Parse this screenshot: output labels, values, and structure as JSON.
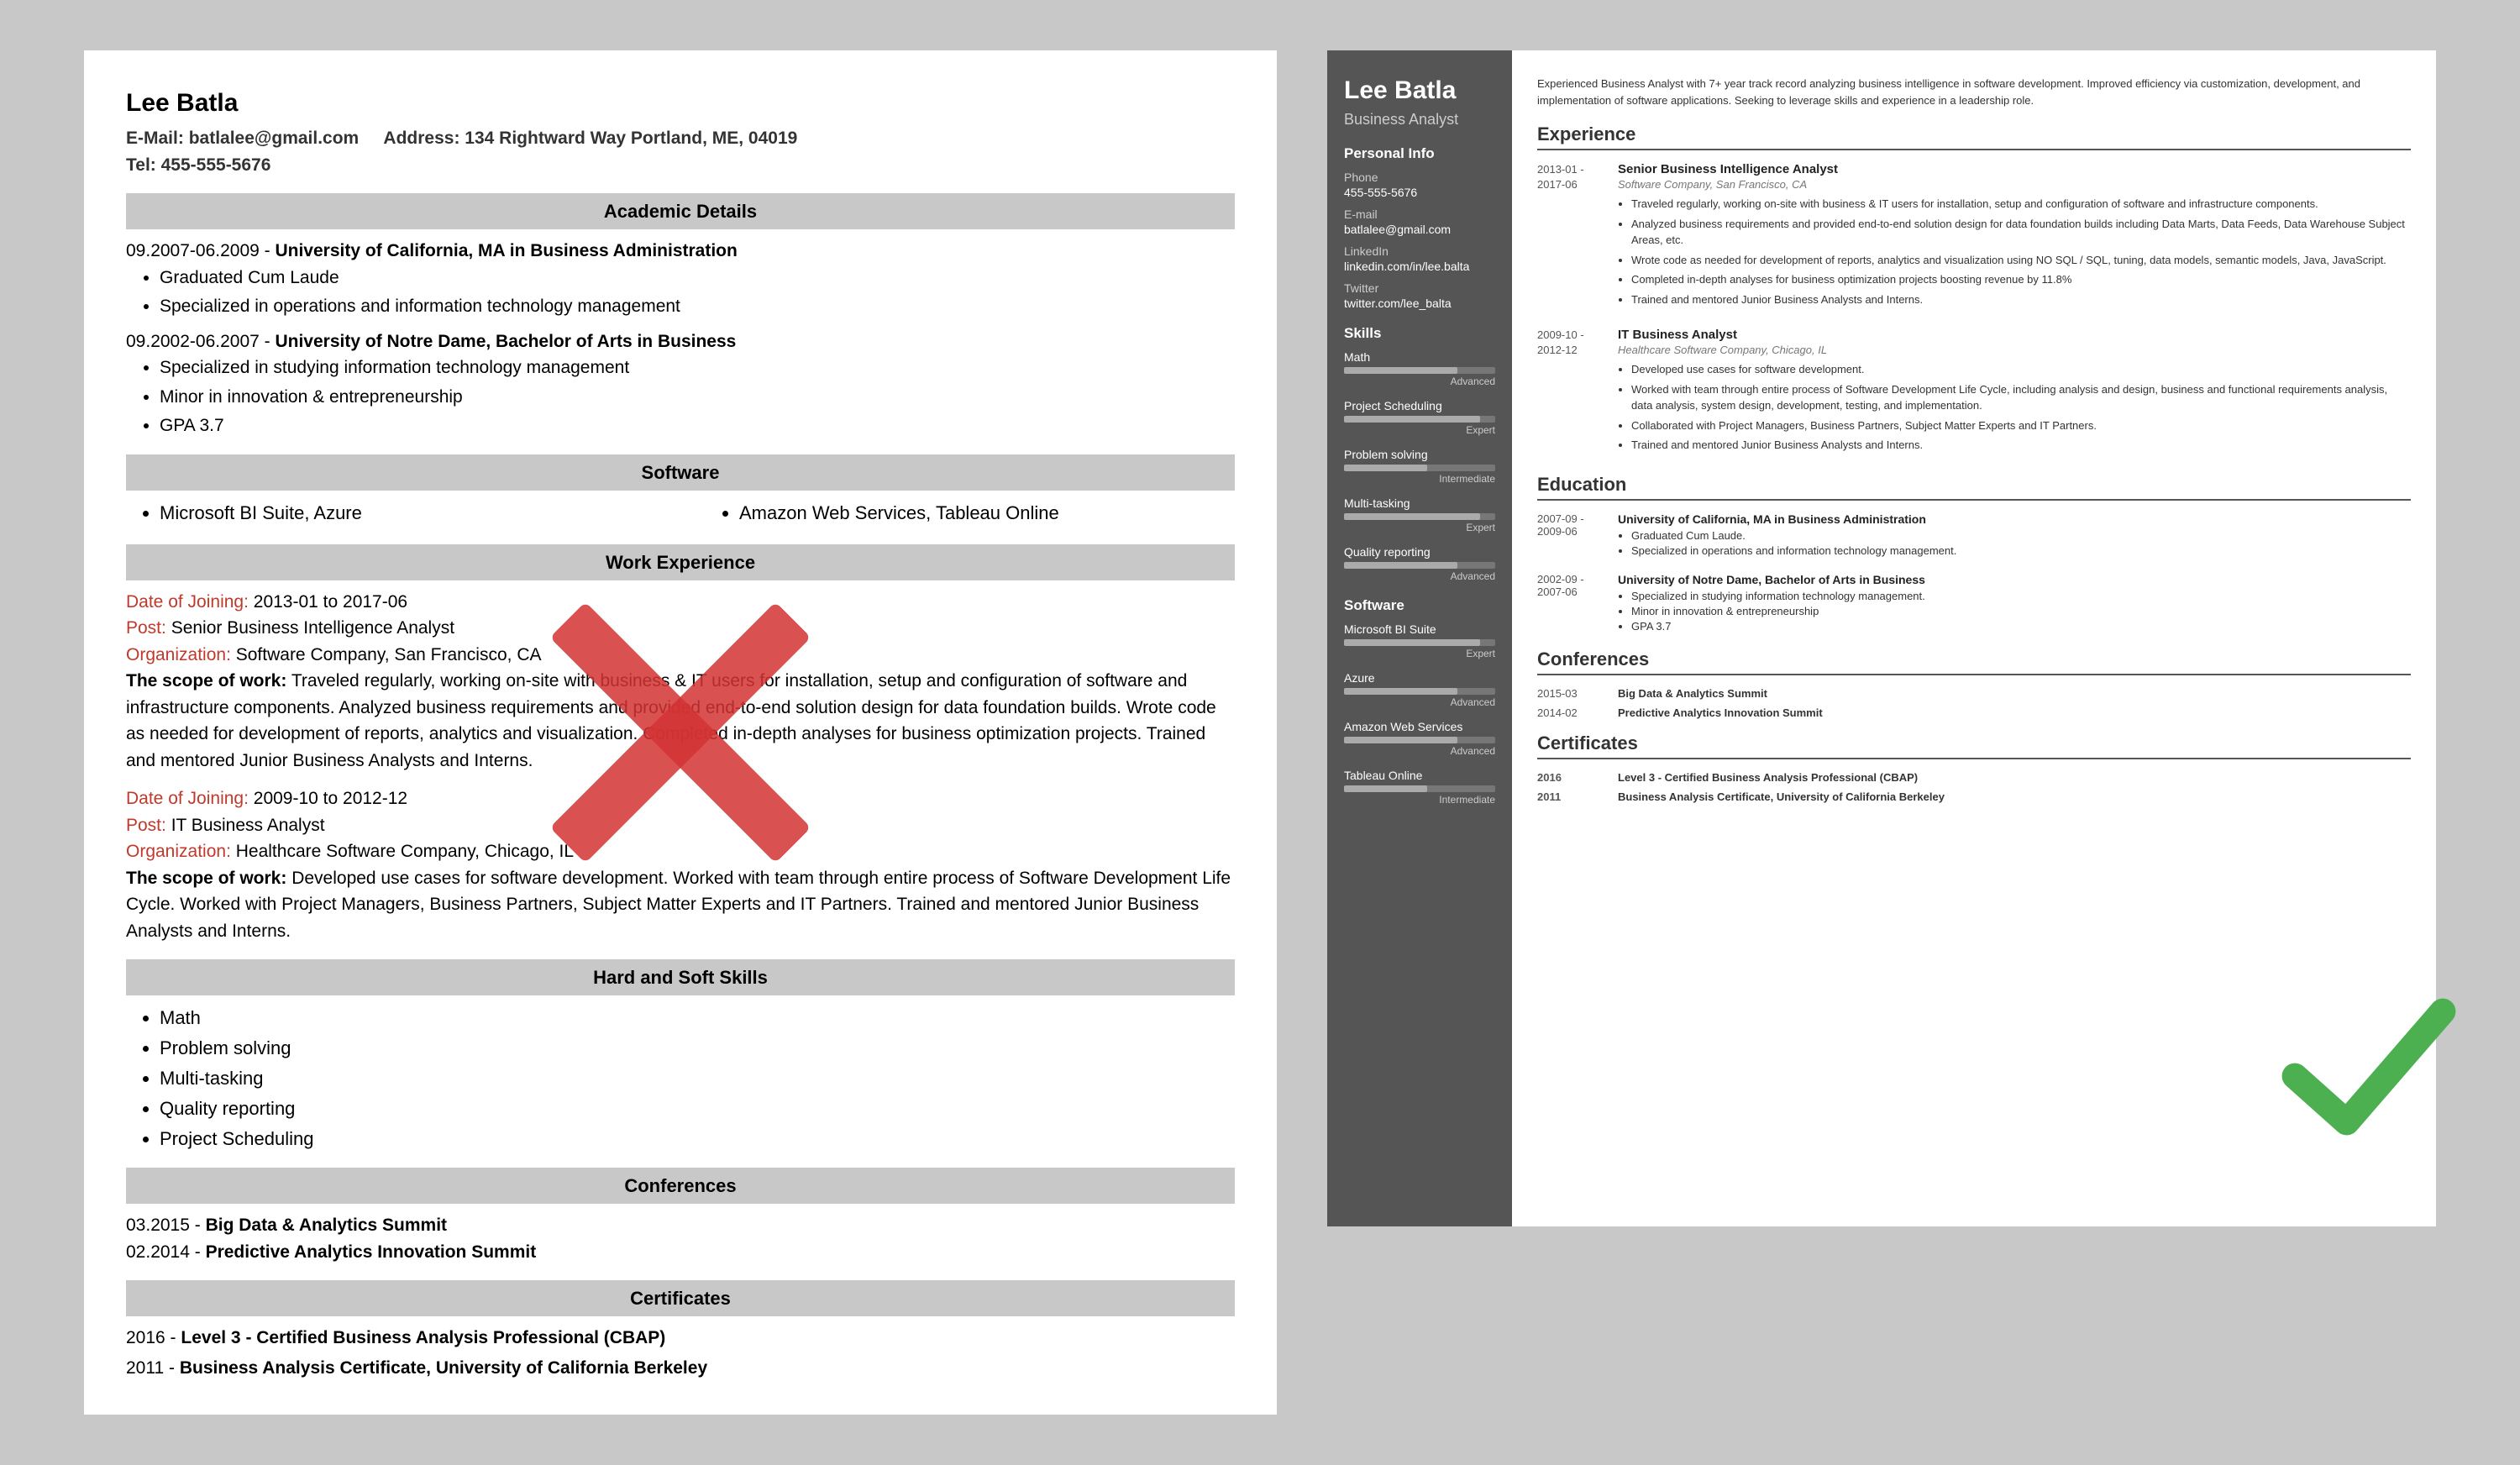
{
  "left_resume": {
    "name": "Lee Batla",
    "email_label": "E-Mail:",
    "email": "batlalee@gmail.com",
    "address_label": "Address:",
    "address": "134 Rightward Way Portland, ME, 04019",
    "tel_label": "Tel:",
    "tel": "455-555-5676",
    "sections": {
      "academic": "Academic Details",
      "software": "Software",
      "work": "Work Experience",
      "skills": "Hard and Soft Skills",
      "conferences": "Conferences",
      "certificates": "Certificates"
    },
    "education": [
      {
        "dates": "09.2007-06.2009",
        "degree": "University of California, MA in Business Administration",
        "bullets": [
          "Graduated Cum Laude",
          "Specialized in operations and information technology management"
        ]
      },
      {
        "dates": "09.2002-06.2007",
        "degree": "University of Notre Dame, Bachelor of Arts in Business",
        "bullets": [
          "Specialized in studying information technology management",
          "Minor in innovation & entrepreneurship",
          "GPA 3.7"
        ]
      }
    ],
    "software_items": [
      "Microsoft BI Suite, Azure",
      "Amazon Web Services, Tableau Online"
    ],
    "work": [
      {
        "date_label": "Date of Joining:",
        "dates": "2013-01 to 2017-06",
        "post_label": "Post:",
        "post": "Senior Business Intelligence Analyst",
        "org_label": "Organization:",
        "org": "Software Company, San Francisco, CA",
        "scope_label": "The scope of work:",
        "scope": "Traveled regularly, working on-site with business & IT users for installation, setup and configuration of software and infrastructure components. Analyzed business requirements and provided end-to-end solution design for data foundation builds. Wrote code as needed for development of reports, analytics and visualization. Completed in-depth analyses for business optimization projects. Trained and mentored Junior Business Analysts and Interns."
      },
      {
        "date_label": "Date of Joining:",
        "dates": "2009-10 to 2012-12",
        "post_label": "Post:",
        "post": "IT Business Analyst",
        "org_label": "Organization:",
        "org": "Healthcare Software Company, Chicago, IL",
        "scope_label": "The scope of work:",
        "scope": "Developed use cases for software development. Worked with team through entire process of Software Development Life Cycle. Worked with Project Managers, Business Partners, Subject Matter Experts and IT Partners. Trained and mentored Junior Business Analysts and Interns."
      }
    ],
    "skills": [
      "Math",
      "Problem solving",
      "Multi-tasking",
      "Quality reporting",
      "Project Scheduling"
    ],
    "conferences": [
      {
        "date": "03.2015",
        "name": "Big Data & Analytics Summit"
      },
      {
        "date": "02.2014",
        "name": "Predictive Analytics Innovation Summit"
      }
    ],
    "certificates": [
      {
        "year": "2016",
        "name": "Level 3 - Certified Business Analysis Professional (CBAP)"
      },
      {
        "year": "2011",
        "name": "Business Analysis Certificate, University of California Berkeley"
      }
    ]
  },
  "right_resume": {
    "name": "Lee Batla",
    "title": "Business Analyst",
    "summary": "Experienced Business Analyst with 7+ year track record analyzing business intelligence in software development. Improved efficiency via customization, development, and implementation of software applications. Seeking to leverage skills and experience in a leadership role.",
    "personal_info_title": "Personal Info",
    "phone_label": "Phone",
    "phone": "455-555-5676",
    "email_label": "E-mail",
    "email": "batlalee@gmail.com",
    "linkedin_label": "LinkedIn",
    "linkedin": "linkedin.com/in/lee.balta",
    "twitter_label": "Twitter",
    "twitter": "twitter.com/lee_balta",
    "skills_title": "Skills",
    "skills": [
      {
        "name": "Math",
        "level": "Advanced",
        "pct": 75
      },
      {
        "name": "Project Scheduling",
        "level": "Expert",
        "pct": 90
      },
      {
        "name": "Problem solving",
        "level": "Intermediate",
        "pct": 55
      },
      {
        "name": "Multi-tasking",
        "level": "Expert",
        "pct": 90
      },
      {
        "name": "Quality reporting",
        "level": "Advanced",
        "pct": 75
      }
    ],
    "software_title": "Software",
    "software": [
      {
        "name": "Microsoft BI Suite",
        "level": "Expert",
        "pct": 90
      },
      {
        "name": "Azure",
        "level": "Advanced",
        "pct": 75
      },
      {
        "name": "Amazon Web Services",
        "level": "Advanced",
        "pct": 75
      },
      {
        "name": "Tableau Online",
        "level": "Intermediate",
        "pct": 55
      }
    ],
    "experience_title": "Experience",
    "experience": [
      {
        "dates": "2013-01 -\n2017-06",
        "title": "Senior Business Intelligence Analyst",
        "company": "Software Company, San Francisco, CA",
        "bullets": [
          "Traveled regularly, working on-site with business & IT users for installation, setup and configuration of software and infrastructure components.",
          "Analyzed business requirements and provided end-to-end solution design for data foundation builds including Data Marts, Data Feeds, Data Warehouse Subject Areas, etc.",
          "Wrote code as needed for development of reports, analytics and visualization using NO SQL / SQL, tuning, data models, semantic models, Java, JavaScript.",
          "Completed in-depth analyses for business optimization projects boosting revenue by 11.8%",
          "Trained and mentored Junior Business Analysts and Interns."
        ]
      },
      {
        "dates": "2009-10 -\n2012-12",
        "title": "IT Business Analyst",
        "company": "Healthcare Software Company, Chicago, IL",
        "bullets": [
          "Developed use cases for software development.",
          "Worked with team through entire process of Software Development Life Cycle, including analysis and design, business and functional requirements analysis, data analysis, system design, development, testing, and implementation.",
          "Collaborated with Project Managers, Business Partners, Subject Matter Experts and IT Partners.",
          "Trained and mentored Junior Business Analysts and Interns."
        ]
      }
    ],
    "education_title": "Education",
    "education": [
      {
        "dates": "2007-09 -\n2009-06",
        "degree": "University of California, MA in Business Administration",
        "bullets": [
          "Graduated Cum Laude.",
          "Specialized in operations and information technology management."
        ]
      },
      {
        "dates": "2002-09 -\n2007-06",
        "degree": "University of Notre Dame, Bachelor of Arts in Business",
        "bullets": [
          "Specialized in studying information technology management.",
          "Minor in innovation & entrepreneurship",
          "GPA 3.7"
        ]
      }
    ],
    "conferences_title": "Conferences",
    "conferences": [
      {
        "date": "2015-03",
        "name": "Big Data & Analytics Summit"
      },
      {
        "date": "2014-02",
        "name": "Predictive Analytics Innovation Summit"
      }
    ],
    "certificates_title": "Certificates",
    "certificates": [
      {
        "year": "2016",
        "name": "Level 3 - Certified Business Analysis Professional (CBAP)"
      },
      {
        "year": "2011",
        "name": "Business Analysis Certificate, University of California Berkeley"
      }
    ]
  }
}
